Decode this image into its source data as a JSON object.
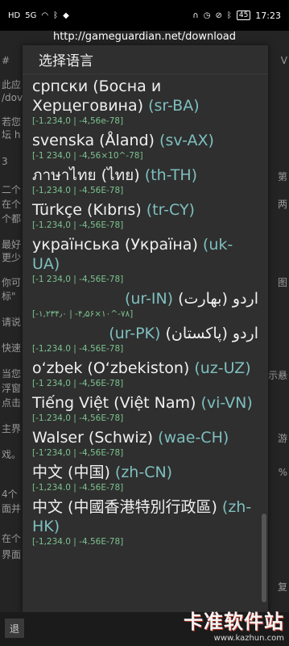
{
  "statusbar": {
    "left_icons": [
      "HD",
      "5G",
      "wifi-icon",
      "bluetooth-icon",
      "shield-app-icon"
    ],
    "right_icons": [
      "headphones-icon",
      "alarm-icon",
      "mute-icon",
      "bluetooth-icon"
    ],
    "battery": "45",
    "time": "17:23"
  },
  "urlbar": {
    "text": "http://gameguardian.net/download"
  },
  "background": {
    "left": [
      "#",
      "此应",
      "/dov",
      "若您",
      "坛 h",
      "3",
      "二个",
      "在个",
      "个都",
      "最好",
      "更少",
      "你可",
      "标\"",
      "请说",
      "快速",
      "当您",
      "浮窗",
      "点击",
      "主界",
      "戏。",
      "4个",
      "面并",
      "在个",
      "界面",
      "退"
    ],
    "right": [
      "V",
      "第",
      "两",
      "图",
      "示悬",
      "游",
      "%",
      "复"
    ]
  },
  "dialog": {
    "title": "选择语言",
    "items": [
      {
        "name": "српски (Босна и Херцеговина)",
        "code": "(sr-BA)",
        "fmt": "[-1.234,0 | -4,56e-78]"
      },
      {
        "name": "svenska (Åland)",
        "code": "(sv-AX)",
        "fmt": "[-1 234,0 | -4,56×10^-78]"
      },
      {
        "name": "ภาษาไทย (ไทย)",
        "code": "(th-TH)",
        "fmt": "[-1,234.0 | -4.56E-78]"
      },
      {
        "name": "Türkçe (Kıbrıs)",
        "code": "(tr-CY)",
        "fmt": "[-1.234,0 | -4,56E-78]"
      },
      {
        "name": "українська (Україна)",
        "code": "(uk-UA)",
        "fmt": "[-1 234,0 | -4,56E-78]"
      },
      {
        "name": "اردو (بھارت)",
        "code": "(ur-IN)",
        "fmt": "[-۱,۲۳۴٫۰ | -۴٫۵۶×۱۰^-۷۸]",
        "rtl": true
      },
      {
        "name": "اردو (پاکستان)",
        "code": "(ur-PK)",
        "fmt": "[-1,234.0 | -4.56E-78]",
        "rtl": true
      },
      {
        "name": "o‘zbek (O‘zbekiston)",
        "code": "(uz-UZ)",
        "fmt": "[-1 234,0 | -4,56E-78]"
      },
      {
        "name": "Tiếng Việt (Việt Nam)",
        "code": "(vi-VN)",
        "fmt": "[-1.234,0 | -4,56E-78]"
      },
      {
        "name": "Walser (Schwiz)",
        "code": "(wae-CH)",
        "fmt": "[-1’234,0 | -4,56E-78]"
      },
      {
        "name": "中文 (中国)",
        "code": "(zh-CN)",
        "fmt": "[-1,234.0 | -4.56E-78]"
      },
      {
        "name": "中文 (中國香港特別行政區)",
        "code": "(zh-HK)",
        "fmt": "[-1,234.0 | -4.56E-78]"
      }
    ]
  },
  "bottom": {
    "left_button": "退",
    "watermark_big": "卡准软件站",
    "watermark_small": "www.kazhun.com"
  },
  "colors": {
    "code": "#7fbfbf",
    "format": "#7cc28f",
    "dialog_bg": "#2f2f2f"
  }
}
